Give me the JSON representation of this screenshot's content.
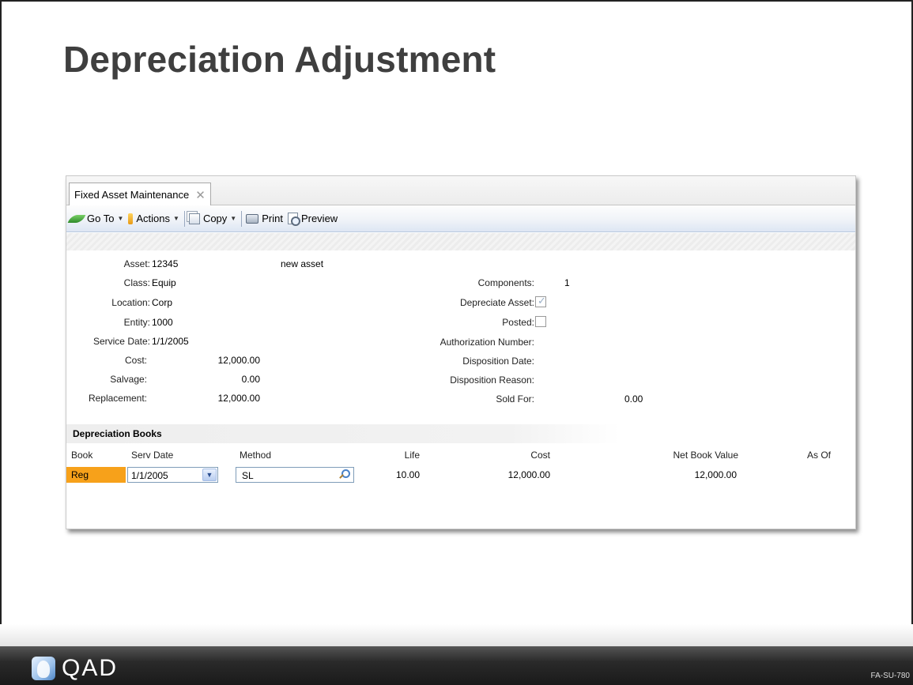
{
  "slide": {
    "title": "Depreciation Adjustment",
    "page_code": "FA-SU-780",
    "logo_text": "QAD"
  },
  "window": {
    "tab_label": "Fixed Asset Maintenance",
    "tab_close": "✕",
    "toolbar": {
      "goto": "Go To",
      "actions": "Actions",
      "copy": "Copy",
      "print": "Print",
      "preview": "Preview",
      "caret": "▼"
    }
  },
  "form": {
    "asset_label": "Asset:",
    "asset_value": "12345",
    "asset_desc": "new asset",
    "class_label": "Class:",
    "class_value": "Equip",
    "location_label": "Location:",
    "location_value": "Corp",
    "entity_label": "Entity:",
    "entity_value": "1000",
    "service_date_label": "Service Date:",
    "service_date_value": "1/1/2005",
    "cost_label": "Cost:",
    "cost_value": "12,000.00",
    "salvage_label": "Salvage:",
    "salvage_value": "0.00",
    "replacement_label": "Replacement:",
    "replacement_value": "12,000.00",
    "components_label": "Components:",
    "components_value": "1",
    "depreciate_label": "Depreciate Asset:",
    "depreciate_checked": true,
    "posted_label": "Posted:",
    "posted_checked": false,
    "authorization_label": "Authorization Number:",
    "disposition_date_label": "Disposition Date:",
    "disposition_reason_label": "Disposition Reason:",
    "sold_for_label": "Sold For:",
    "sold_for_value": "0.00"
  },
  "books": {
    "section_title": "Depreciation Books",
    "columns": {
      "book": "Book",
      "serv_date": "Serv Date",
      "method": "Method",
      "life": "Life",
      "cost": "Cost",
      "nbv": "Net Book Value",
      "as_of": "As Of"
    },
    "rows": [
      {
        "book": "Reg",
        "serv_date": "1/1/2005",
        "method": "SL",
        "life": "10.00",
        "cost": "12,000.00",
        "nbv": "12,000.00",
        "as_of": ""
      }
    ]
  },
  "colors": {
    "book_highlight": "#f7a11a",
    "toolbar_border": "#b8c8df"
  }
}
